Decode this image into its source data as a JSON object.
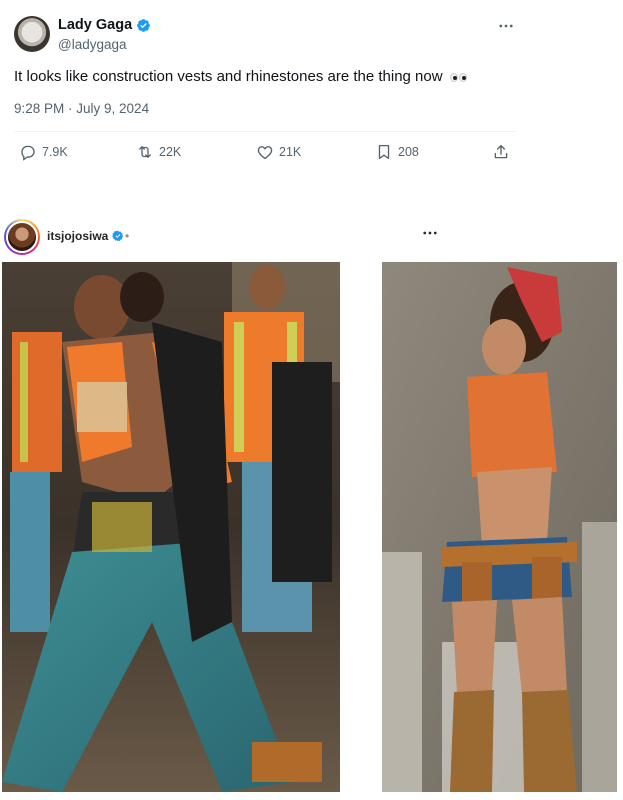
{
  "tweet": {
    "author_name": "Lady Gaga",
    "handle": "@ladygaga",
    "text": "It looks like construction vests and rhinestones are the thing now",
    "emoji": "eyes-emoji",
    "timestamp": "9:28 PM · July 9, 2024",
    "actions": {
      "replies": "7.9K",
      "reposts": "22K",
      "likes": "21K",
      "bookmarks": "208"
    }
  },
  "instagram_post": {
    "username": "itsjojosiwa",
    "separator": "•"
  },
  "colors": {
    "verified": "#1d9bf0",
    "text_primary": "#0f1419",
    "text_secondary": "#536471",
    "safety_orange": "#f0772b"
  },
  "icons": [
    "verified-badge-icon",
    "more-horizontal-icon",
    "reply-icon",
    "repost-icon",
    "like-icon",
    "bookmark-icon",
    "share-icon"
  ]
}
